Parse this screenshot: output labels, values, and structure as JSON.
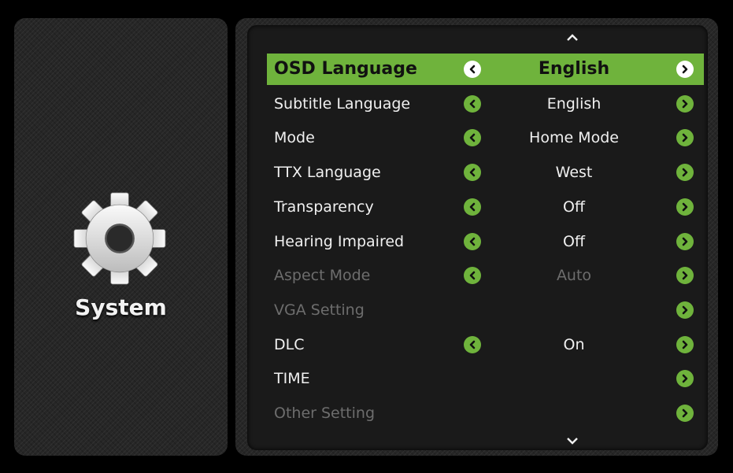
{
  "category": {
    "title": "System",
    "icon": "gear-icon"
  },
  "colors": {
    "accent": "#6fb33c",
    "panel": "#262626",
    "menu_bg": "#1a1a1a",
    "text": "#f0f0f0",
    "disabled_text": "#6d6d6d"
  },
  "menu": {
    "scroll_up_icon": "chevron-up-icon",
    "scroll_down_icon": "chevron-down-icon",
    "items": [
      {
        "label": "OSD Language",
        "value": "English",
        "selected": true,
        "disabled": false,
        "has_left": true,
        "has_right": true
      },
      {
        "label": "Subtitle Language",
        "value": "English",
        "selected": false,
        "disabled": false,
        "has_left": true,
        "has_right": true
      },
      {
        "label": "Mode",
        "value": "Home Mode",
        "selected": false,
        "disabled": false,
        "has_left": true,
        "has_right": true
      },
      {
        "label": "TTX  Language",
        "value": "West",
        "selected": false,
        "disabled": false,
        "has_left": true,
        "has_right": true
      },
      {
        "label": "Transparency",
        "value": "Off",
        "selected": false,
        "disabled": false,
        "has_left": true,
        "has_right": true
      },
      {
        "label": "Hearing Impaired",
        "value": "Off",
        "selected": false,
        "disabled": false,
        "has_left": true,
        "has_right": true
      },
      {
        "label": "Aspect Mode",
        "value": "Auto",
        "selected": false,
        "disabled": true,
        "has_left": true,
        "has_right": true
      },
      {
        "label": "VGA Setting",
        "value": "",
        "selected": false,
        "disabled": true,
        "has_left": false,
        "has_right": true
      },
      {
        "label": "DLC",
        "value": "On",
        "selected": false,
        "disabled": false,
        "has_left": true,
        "has_right": true
      },
      {
        "label": "TIME",
        "value": "",
        "selected": false,
        "disabled": false,
        "has_left": false,
        "has_right": true
      },
      {
        "label": "Other Setting",
        "value": "",
        "selected": false,
        "disabled": true,
        "has_left": false,
        "has_right": true
      }
    ]
  }
}
